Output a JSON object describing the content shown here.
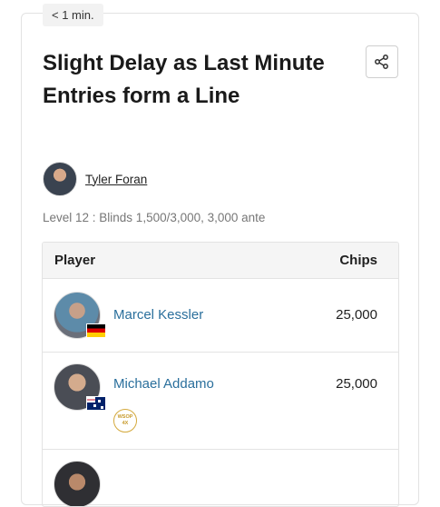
{
  "post": {
    "read_time": "< 1 min.",
    "title": "Slight Delay as Last Minute Entries form a Line",
    "author": "Tyler Foran",
    "level": "Level 12 : Blinds 1,500/3,000, 3,000 ante"
  },
  "table": {
    "headers": {
      "player": "Player",
      "chips": "Chips"
    },
    "rows": [
      {
        "name": "Marcel Kessler",
        "chips": "25,000",
        "flag": "germany-flag"
      },
      {
        "name": "Michael Addamo",
        "chips": "25,000",
        "flag": "australia-flag",
        "badge_top": "WSOP",
        "badge_bottom": "4X"
      }
    ]
  },
  "icons": {
    "share": "share-icon"
  },
  "colors": {
    "link": "#2a6f9c",
    "badge_gold": "#d4a93c"
  }
}
